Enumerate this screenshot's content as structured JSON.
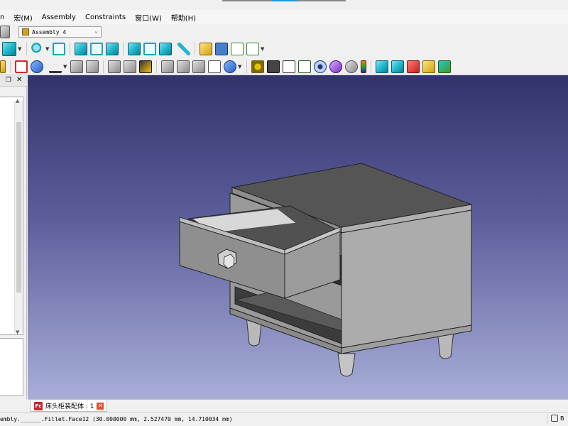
{
  "menu": {
    "items": [
      "n",
      "宏(M)",
      "Assembly",
      "Constraints",
      "窗口(W)",
      "帮助(H)"
    ]
  },
  "toolbar": {
    "workbench_label": "Assembly 4"
  },
  "left_panel": {
    "float_label": "❐",
    "close_label": "✕"
  },
  "document_tab": {
    "logo": "Fc",
    "label": "床头柜装配体 : 1",
    "close": "✕"
  },
  "status": {
    "message": "embly.______.Fillet.Face12 (30.000000 mm, 2.527470 mm, 14.710034 mm)",
    "nav_label": "B"
  },
  "colors": {
    "bg_top": "#32336b",
    "bg_bottom": "#a8aed8",
    "model_gray": "#a9a9a9"
  }
}
